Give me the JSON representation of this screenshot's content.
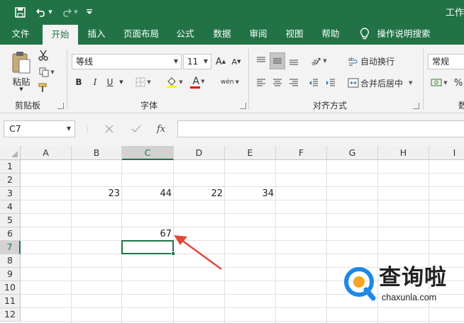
{
  "title": "工作",
  "tabs": [
    {
      "label": "文件",
      "active": false
    },
    {
      "label": "开始",
      "active": true
    },
    {
      "label": "插入",
      "active": false
    },
    {
      "label": "页面布局",
      "active": false
    },
    {
      "label": "公式",
      "active": false
    },
    {
      "label": "数据",
      "active": false
    },
    {
      "label": "审阅",
      "active": false
    },
    {
      "label": "视图",
      "active": false
    },
    {
      "label": "帮助",
      "active": false
    }
  ],
  "tell_me": "操作说明搜索",
  "ribbon": {
    "clipboard": {
      "paste": "粘贴",
      "group": "剪贴板"
    },
    "font": {
      "name": "等线",
      "size": "11",
      "bold": "B",
      "italic": "I",
      "underline": "U",
      "font_color_letter": "A",
      "wen": "wén",
      "group": "字体"
    },
    "alignment": {
      "wrap": "自动换行",
      "merge": "合并后居中",
      "group": "对齐方式"
    },
    "number": {
      "format": "常规",
      "group_partial": "数"
    }
  },
  "formula_bar": {
    "name_box": "C7",
    "fx": "fx",
    "value": ""
  },
  "columns": [
    "A",
    "B",
    "C",
    "D",
    "E",
    "F",
    "G",
    "H",
    "I"
  ],
  "rows": [
    "1",
    "2",
    "3",
    "4",
    "5",
    "6",
    "7",
    "8",
    "9",
    "10",
    "11",
    "12"
  ],
  "cells": {
    "B3": "23",
    "C3": "44",
    "D3": "22",
    "E3": "34",
    "C6": "67"
  },
  "selected": {
    "column": "C",
    "row": "7"
  },
  "watermark": {
    "brand": "查询啦",
    "url": "chaxunla.com"
  },
  "colors": {
    "accent": "#217346",
    "arrow": "#e0483b",
    "watermark_blue": "#1e88e5",
    "watermark_orange": "#f5a623"
  }
}
